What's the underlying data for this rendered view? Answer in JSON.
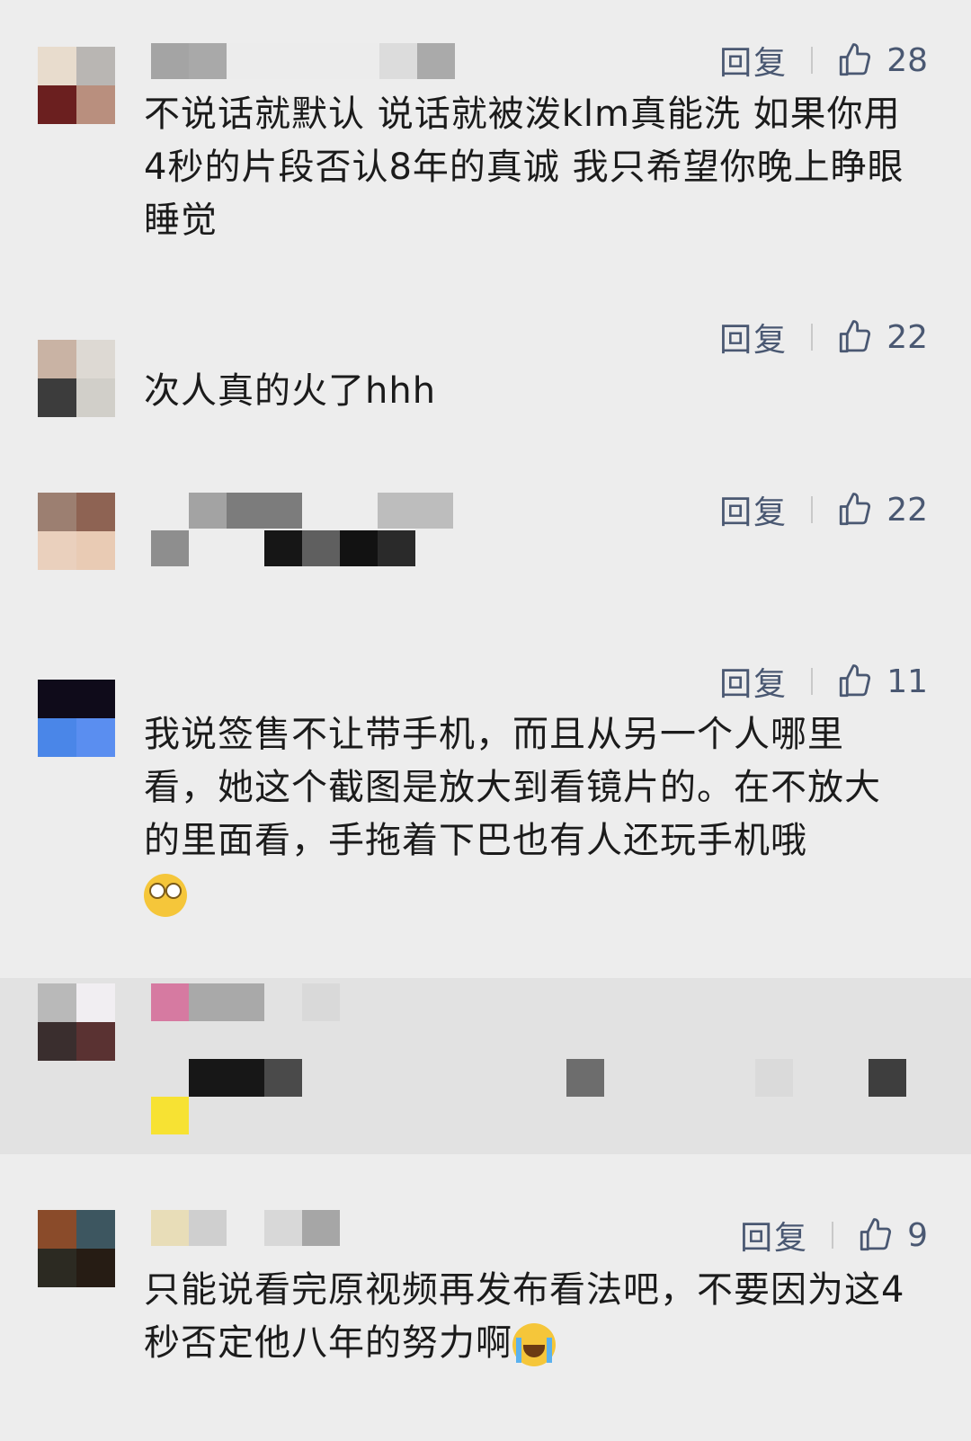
{
  "comments": [
    {
      "reply_label": "回复",
      "likes": "28",
      "text": "不说话就默认 说话就被泼klm真能洗 如果你用4秒的片段否认8年的真诚 我只希望你晚上睁眼睡觉"
    },
    {
      "reply_label": "回复",
      "likes": "22",
      "text": "次人真的火了hhh"
    },
    {
      "reply_label": "回复",
      "likes": "22",
      "text": ""
    },
    {
      "reply_label": "回复",
      "likes": "11",
      "text": "我说签售不让带手机，而且从另一个人哪里看，她这个截图是放大到看镜片的。在不放大的里面看，手拖着下巴也有人还玩手机哦",
      "emoji": "eye-roll-emoji"
    },
    {
      "reply_label": "",
      "likes": "",
      "text": ""
    },
    {
      "reply_label": "回复",
      "likes": "9",
      "text": "只能说看完原视频再发布看法吧，不要因为这4秒否定他八年的努力啊",
      "emoji": "crying-emoji"
    }
  ],
  "icons": {
    "like": "thumbs-up-icon"
  },
  "colors": {
    "background": "#ededed",
    "action_text": "#4a5872",
    "body_text": "#1b1b1b"
  }
}
